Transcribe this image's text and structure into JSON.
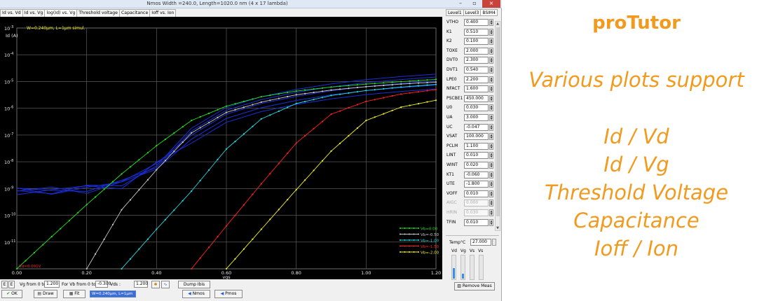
{
  "window": {
    "title": "Nmos Width =240.0, Length=1020.0 nm (4 x 17 lambda)",
    "minimize": "–",
    "restore": "▫",
    "close": "×"
  },
  "tabs": [
    {
      "label": "Id vs. Vd"
    },
    {
      "label": "Id vs. Vg"
    },
    {
      "label": "log(Id) vs. Vg"
    },
    {
      "label": "Threshold voltage"
    },
    {
      "label": "Capacitance"
    },
    {
      "label": "Ioff vs. Ion"
    }
  ],
  "right_tabs": [
    {
      "label": "Level1"
    },
    {
      "label": "Level3"
    },
    {
      "label": "BSIM4"
    }
  ],
  "params": [
    {
      "name": "VTHO",
      "value": "0.400"
    },
    {
      "name": "K1",
      "value": "0.510"
    },
    {
      "name": "K2",
      "value": "0.100"
    },
    {
      "name": "TOXE",
      "value": "2.000"
    },
    {
      "name": "DVT0",
      "value": "2.300"
    },
    {
      "name": "DVT1",
      "value": "0.540"
    },
    {
      "name": "LPE0",
      "value": "2.200"
    },
    {
      "name": "NFACT",
      "value": "1.600"
    },
    {
      "name": "PSCBE1",
      "value": "450.000"
    },
    {
      "name": "U0",
      "value": "0.030"
    },
    {
      "name": "UA",
      "value": "3.000"
    },
    {
      "name": "UC",
      "value": "-0.047"
    },
    {
      "name": "VSAT",
      "value": "100.000"
    },
    {
      "name": "PCLM",
      "value": "1.100"
    },
    {
      "name": "LINT",
      "value": "0.010"
    },
    {
      "name": "WINT",
      "value": "0.020"
    },
    {
      "name": "KT1",
      "value": "-0.060"
    },
    {
      "name": "UTE",
      "value": "-1.800"
    },
    {
      "name": "VOFF",
      "value": "0.010"
    },
    {
      "name": "AIGC",
      "value": "0.000",
      "disabled": true
    },
    {
      "name": "HRIN",
      "value": "0.030",
      "disabled": true
    },
    {
      "name": "TFIN",
      "value": "0.010"
    }
  ],
  "temperature": {
    "label": "Temp°C",
    "value": "27.000"
  },
  "voltage_labels": [
    "Vd",
    "Vg",
    "Vs",
    "Vs"
  ],
  "slider_levels": [
    0.45,
    0.2,
    0.0,
    0.0
  ],
  "remove_meas": "Remove Meas",
  "bottom": {
    "vg_label": "Vg from 0 to:",
    "vg_value": "1.200",
    "vb_label": "For Vb from 0 to:",
    "vb_value": "-0.300",
    "vds_label": "Vds :",
    "vds_value": "1.200",
    "dump_label": "Dump Ibis",
    "ok_label": "OK",
    "draw_label": "Draw",
    "fit_label": "Fit",
    "select_value": "W=0.240µm, L=1µm",
    "nmos_label": "Nmos",
    "pmos_label": "Pmos",
    "e1": "E",
    "e2": "E"
  },
  "chart_data": {
    "type": "line",
    "ylabel": "Id (A)",
    "xlabel": "vgs",
    "yscale": "log",
    "xlim": [
      0,
      1.2
    ],
    "ylim": [
      1e-12,
      0.0001
    ],
    "x_ticks": [
      "0.00",
      "0.20",
      "0.40",
      "0.60",
      "0.80",
      "1.00",
      "1.20"
    ],
    "y_ticks": [
      "10^-3",
      "10^-4",
      "10^-5",
      "10^-6",
      "10^-7",
      "10^-8",
      "10^-9",
      "10^-10",
      "10^-11"
    ],
    "annotation": "W=0.240µm, L=1µm simul.",
    "annotation2": "Vd=0.001V",
    "legend": [
      {
        "name": "Vb=0.00",
        "color": "#22e022"
      },
      {
        "name": "Vb=-0.50",
        "color": "#c8c8c8"
      },
      {
        "name": "Vb=-1.00",
        "color": "#22d8e0"
      },
      {
        "name": "Vb=-1.50",
        "color": "#ff2020"
      },
      {
        "name": "Vb=-2.00",
        "color": "#f0f020"
      }
    ],
    "series": [
      {
        "name": "Vb=0.00",
        "color": "#22e022",
        "x": [
          0.0,
          0.1,
          0.2,
          0.3,
          0.4,
          0.5,
          0.6,
          0.7,
          0.8,
          0.9,
          1.0,
          1.1,
          1.2
        ],
        "y": [
          1e-12,
          1.6e-11,
          2.5e-10,
          3.5e-09,
          4e-08,
          3.5e-07,
          1.2e-06,
          2.7e-06,
          4.4e-06,
          6.2e-06,
          8e-06,
          9.9e-06,
          1.2e-05
        ]
      },
      {
        "name": "Vb=-0.50",
        "color": "#c8c8c8",
        "x": [
          0.2,
          0.3,
          0.4,
          0.5,
          0.6,
          0.7,
          0.8,
          0.9,
          1.0,
          1.1,
          1.2
        ],
        "y": [
          1e-12,
          1.6e-10,
          5e-09,
          1.2e-07,
          7e-07,
          1.7e-06,
          3.2e-06,
          4.8e-06,
          6.4e-06,
          8e-06,
          9.5e-06
        ]
      },
      {
        "name": "Vb=-1.00",
        "color": "#22d8e0",
        "x": [
          0.3,
          0.4,
          0.5,
          0.6,
          0.7,
          0.8,
          0.9,
          1.0,
          1.1,
          1.2
        ],
        "y": [
          1e-12,
          3e-11,
          8e-10,
          3e-08,
          4e-07,
          1.5e-06,
          3e-06,
          4.6e-06,
          6.2e-06,
          7.8e-06
        ]
      },
      {
        "name": "Vb=-1.50",
        "color": "#ff2020",
        "x": [
          0.5,
          0.6,
          0.7,
          0.8,
          0.9,
          1.0,
          1.1,
          1.2
        ],
        "y": [
          1e-12,
          4e-11,
          1.5e-09,
          5e-08,
          6e-07,
          1.8e-06,
          3.4e-06,
          5e-06
        ]
      },
      {
        "name": "Vb=-2.00",
        "color": "#f0f020",
        "x": [
          0.6,
          0.7,
          0.8,
          0.9,
          1.0,
          1.1,
          1.2
        ],
        "y": [
          1e-12,
          3e-11,
          9e-10,
          2.5e-08,
          3.5e-07,
          1.1e-06,
          2e-06
        ]
      }
    ],
    "measured": {
      "color": "#1a2fd8",
      "x": [
        0.0,
        0.1,
        0.2,
        0.3,
        0.4,
        0.5,
        0.6,
        0.7,
        0.8,
        0.9,
        1.0,
        1.1,
        1.2
      ],
      "y": [
        8e-10,
        9e-10,
        1e-09,
        1.5e-09,
        8e-09,
        1e-07,
        6e-07,
        1.5e-06,
        2.8e-06,
        4.5e-06,
        6.5e-06,
        8.5e-06,
        1.05e-05
      ]
    }
  },
  "promo": {
    "brand": "proTutor",
    "subtitle": "Various plots support",
    "items": [
      "Id / Vd",
      "Id / Vg",
      "Threshold Voltage",
      "Capacitance",
      "Ioff / Ion"
    ]
  }
}
